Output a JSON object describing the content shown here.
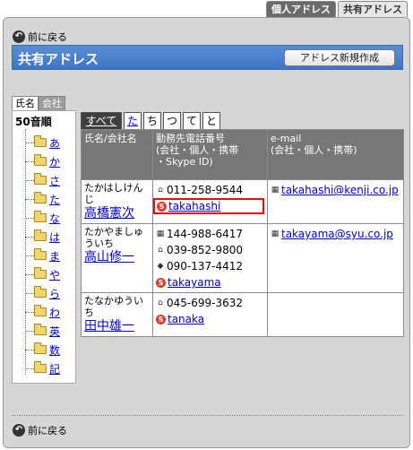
{
  "top_tabs": {
    "personal": "個人アドレス",
    "shared": "共有アドレス"
  },
  "back_top": "前に戻る",
  "back_bottom": "前に戻る",
  "title": "共有アドレス",
  "new_button": "アドレス新規作成",
  "left_tabs": [
    "氏名",
    "会社"
  ],
  "tree_root": "50音順",
  "tree_items": [
    "あ",
    "か",
    "さ",
    "た",
    "な",
    "は",
    "ま",
    "や",
    "ら",
    "わ",
    "英",
    "数",
    "記"
  ],
  "index_tabs": [
    "すべて",
    "た",
    "ち",
    "つ",
    "て",
    "と"
  ],
  "columns": {
    "name": "氏名/会社名",
    "phone": "勤務先電話番号\n(会社・個人・携帯\n・Skype ID)",
    "email": "e-mail\n(会社・個人・携帯)"
  },
  "rows": [
    {
      "kana": "たかはしけんじ",
      "name": "高橋憲次",
      "phones": [
        {
          "icon": "home",
          "text": "011-258-9544"
        }
      ],
      "skype": "takahashi",
      "emails": [
        "takahashi@kenji.co.jp"
      ]
    },
    {
      "kana": "たかやましゅういち",
      "name": "高山修一",
      "phones": [
        {
          "icon": "office",
          "text": "144-988-6417"
        },
        {
          "icon": "home",
          "text": "039-852-9800"
        },
        {
          "icon": "mobile",
          "text": "090-137-4412"
        }
      ],
      "skype": "takayama",
      "emails": [
        "takayama@syu.co.jp"
      ]
    },
    {
      "kana": "たなかゆういち",
      "name": "田中雄一",
      "phones": [
        {
          "icon": "home",
          "text": "045-699-3632"
        }
      ],
      "skype": "tanaka",
      "emails": []
    }
  ]
}
